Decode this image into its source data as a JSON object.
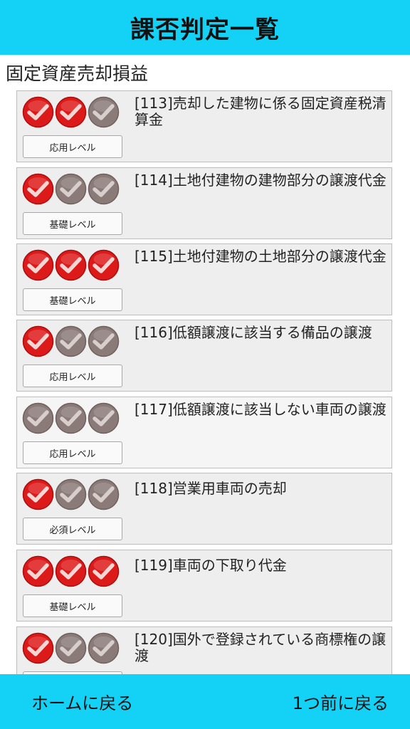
{
  "header": {
    "title": "課否判定一覧"
  },
  "section": {
    "title": "固定資産売却損益"
  },
  "colors": {
    "accent": "#13d2f5",
    "check_on": "#dd1a1a",
    "check_off": "#8a7a78"
  },
  "items": [
    {
      "title": "[113]売却した建物に係る固定資産税清算金",
      "level": "応用レベル",
      "checks": [
        true,
        true,
        false
      ]
    },
    {
      "title": "[114]土地付建物の建物部分の譲渡代金",
      "level": "基礎レベル",
      "checks": [
        true,
        false,
        false
      ]
    },
    {
      "title": "[115]土地付建物の土地部分の譲渡代金",
      "level": "基礎レベル",
      "checks": [
        true,
        true,
        true
      ]
    },
    {
      "title": "[116]低額譲渡に該当する備品の譲渡",
      "level": "応用レベル",
      "checks": [
        true,
        false,
        false
      ]
    },
    {
      "title": "[117]低額譲渡に該当しない車両の譲渡",
      "level": "応用レベル",
      "checks": [
        false,
        false,
        false
      ]
    },
    {
      "title": "[118]営業用車両の売却",
      "level": "必須レベル",
      "checks": [
        true,
        false,
        false
      ]
    },
    {
      "title": "[119]車両の下取り代金",
      "level": "基礎レベル",
      "checks": [
        true,
        true,
        true
      ]
    },
    {
      "title": "[120]国外で登録されている商標権の譲渡",
      "level": "",
      "checks": [
        true,
        false,
        false
      ]
    }
  ],
  "footer": {
    "home_label": "ホームに戻る",
    "back_label": "1つ前に戻る"
  }
}
